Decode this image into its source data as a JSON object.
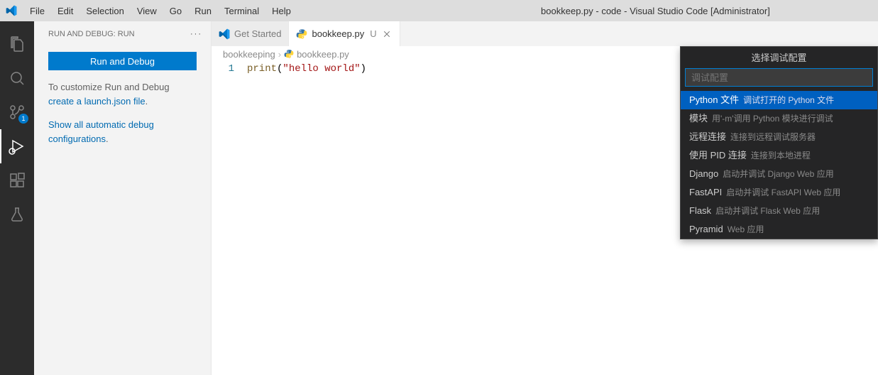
{
  "titlebar": {
    "menu": [
      "File",
      "Edit",
      "Selection",
      "View",
      "Go",
      "Run",
      "Terminal",
      "Help"
    ],
    "title": "bookkeep.py - code - Visual Studio Code [Administrator]"
  },
  "activitybar": {
    "source_control_badge": "1"
  },
  "sidebar": {
    "header": "RUN AND DEBUG: RUN",
    "run_button": "Run and Debug",
    "text_prefix": "To customize Run and Debug ",
    "link_create": "create a launch.json file",
    "text_suffix": ".",
    "show_all_link": "Show all automatic debug configurations",
    "show_all_suffix": "."
  },
  "tabs": [
    {
      "label": "Get Started",
      "active": false,
      "icon": "vscode",
      "status": "",
      "closable": false
    },
    {
      "label": "bookkeep.py",
      "active": true,
      "icon": "python",
      "status": "U",
      "closable": true
    }
  ],
  "breadcrumbs": {
    "items": [
      "bookkeeping",
      "bookkeep.py"
    ]
  },
  "editor": {
    "line_number": "1",
    "tok_fn": "print",
    "tok_open": "(",
    "tok_str": "\"hello world\"",
    "tok_close": ")"
  },
  "quickpick": {
    "title": "选择调试配置",
    "placeholder": "调试配置",
    "items": [
      {
        "label": "Python 文件",
        "desc": "调试打开的 Python 文件",
        "selected": true
      },
      {
        "label": "模块",
        "desc": "用'-m'调用 Python 模块进行调试",
        "selected": false
      },
      {
        "label": "远程连接",
        "desc": "连接到远程调试服务器",
        "selected": false
      },
      {
        "label": "使用 PID 连接",
        "desc": "连接到本地进程",
        "selected": false
      },
      {
        "label": "Django",
        "desc": "启动并调试 Django Web 应用",
        "selected": false
      },
      {
        "label": "FastAPI",
        "desc": "启动并调试 FastAPI Web 应用",
        "selected": false
      },
      {
        "label": "Flask",
        "desc": "启动并调试 Flask Web 应用",
        "selected": false
      },
      {
        "label": "Pyramid",
        "desc": "Web 应用",
        "selected": false
      }
    ]
  }
}
